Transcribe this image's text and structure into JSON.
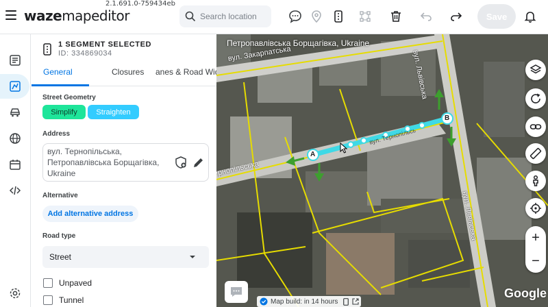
{
  "app": {
    "version": "2.1.691.0-759434eb",
    "logo_bold": "waze",
    "logo_thin": "mapeditor"
  },
  "search": {
    "placeholder": "Search location"
  },
  "toolbar": {
    "save_label": "Save"
  },
  "panel": {
    "selection_title": "1 SEGMENT SELECTED",
    "segment_id": "ID: 334869034",
    "tabs": [
      {
        "label": "General",
        "active": true
      },
      {
        "label": "Closures",
        "active": false
      },
      {
        "label": "anes & Road Wid",
        "active": false
      }
    ],
    "street_geometry_label": "Street Geometry",
    "simplify_label": "Simplify",
    "straighten_label": "Straighten",
    "address_label": "Address",
    "address_value": "вул. Тернопільська, Петропавлівська Борщагівка, Ukraine",
    "alternative_label": "Alternative",
    "add_alt_label": "Add alternative address",
    "road_type_label": "Road type",
    "road_type_value": "Street",
    "unpaved_label": "Unpaved",
    "tunnel_label": "Tunnel"
  },
  "map": {
    "location_title": "Петропавлівська Борщагівка, Ukraine",
    "street_labels": [
      "вул. Закарпатська",
      "вул. Львівська",
      "вул. Тернопільська",
      "вул. Львівська",
      "вул. Тернопільська"
    ],
    "node_a": "A",
    "node_b": "B",
    "build_info": "Map build: in 14 hours",
    "attribution": "Google"
  },
  "colors": {
    "accent": "#0075e3",
    "simplify_bg": "#1ee59a",
    "straighten_bg": "#33ccff",
    "segment": "#3fd9e6",
    "arrow": "#3d9f2e",
    "roads": "#e6dc00"
  }
}
